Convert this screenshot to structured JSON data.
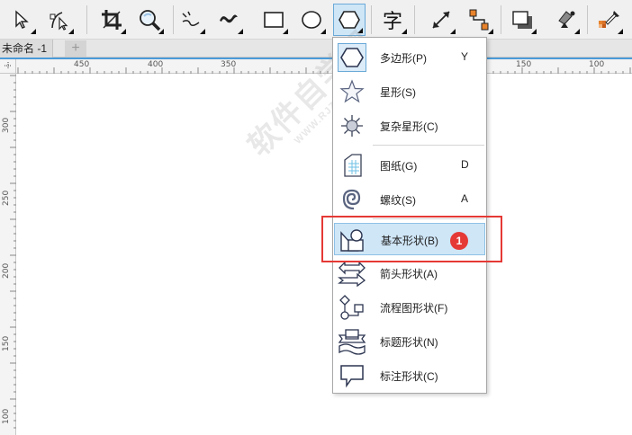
{
  "toolbar": {
    "tools": [
      {
        "name": "pick-tool",
        "icon": "arrow-cursor-icon"
      },
      {
        "name": "shape-tool",
        "icon": "shape-edit-icon"
      },
      {
        "name": "crop-tool",
        "icon": "crop-icon"
      },
      {
        "name": "zoom-tool",
        "icon": "magnifier-icon"
      },
      {
        "name": "freehand-tool",
        "icon": "freehand-curve-icon"
      },
      {
        "name": "artistic-media-tool",
        "icon": "artistic-media-icon"
      },
      {
        "name": "rectangle-tool",
        "icon": "rectangle-icon"
      },
      {
        "name": "ellipse-tool",
        "icon": "ellipse-icon"
      },
      {
        "name": "polygon-tool",
        "icon": "hexagon-icon",
        "active": true
      },
      {
        "name": "text-tool",
        "icon": "text-icon",
        "glyph": "字"
      },
      {
        "name": "dimension-tool",
        "icon": "dimension-arrow-icon"
      },
      {
        "name": "connector-tool",
        "icon": "connector-icon"
      },
      {
        "name": "drop-shadow-tool",
        "icon": "drop-shadow-icon"
      },
      {
        "name": "transparency-tool",
        "icon": "transparency-icon"
      },
      {
        "name": "eyedropper-tool",
        "icon": "eyedropper-icon"
      }
    ]
  },
  "document": {
    "tab_label": "未命名 -1",
    "add_tab_label": "+"
  },
  "rulers": {
    "horizontal_ticks": [
      "450",
      "400",
      "350",
      "150",
      "100"
    ],
    "vertical_ticks": [
      "300",
      "250",
      "200",
      "150",
      "100"
    ]
  },
  "flyout": {
    "items": [
      {
        "label": "多边形(P)",
        "key": "Y",
        "icon": "hexagon-icon"
      },
      {
        "label": "星形(S)",
        "key": "",
        "icon": "star-icon"
      },
      {
        "label": "复杂星形(C)",
        "key": "",
        "icon": "complex-star-icon"
      },
      {
        "label": "图纸(G)",
        "key": "D",
        "icon": "graph-paper-icon"
      },
      {
        "label": "螺纹(S)",
        "key": "A",
        "icon": "spiral-icon"
      },
      {
        "label": "基本形状(B)",
        "key": "",
        "icon": "basic-shapes-icon",
        "highlighted": true
      },
      {
        "label": "箭头形状(A)",
        "key": "",
        "icon": "arrow-shapes-icon"
      },
      {
        "label": "流程图形状(F)",
        "key": "",
        "icon": "flowchart-shapes-icon"
      },
      {
        "label": "标题形状(N)",
        "key": "",
        "icon": "banner-shapes-icon"
      },
      {
        "label": "标注形状(C)",
        "key": "",
        "icon": "callout-shapes-icon"
      }
    ]
  },
  "annotation": {
    "step_badge": "1",
    "highlight_color": "#e53935"
  },
  "watermark": {
    "text": "软件自学网",
    "subtext": "WWW.RJZXW.COM"
  },
  "colors": {
    "accent_blue": "#4a9bd8",
    "menu_highlight": "#cfe6f7"
  }
}
